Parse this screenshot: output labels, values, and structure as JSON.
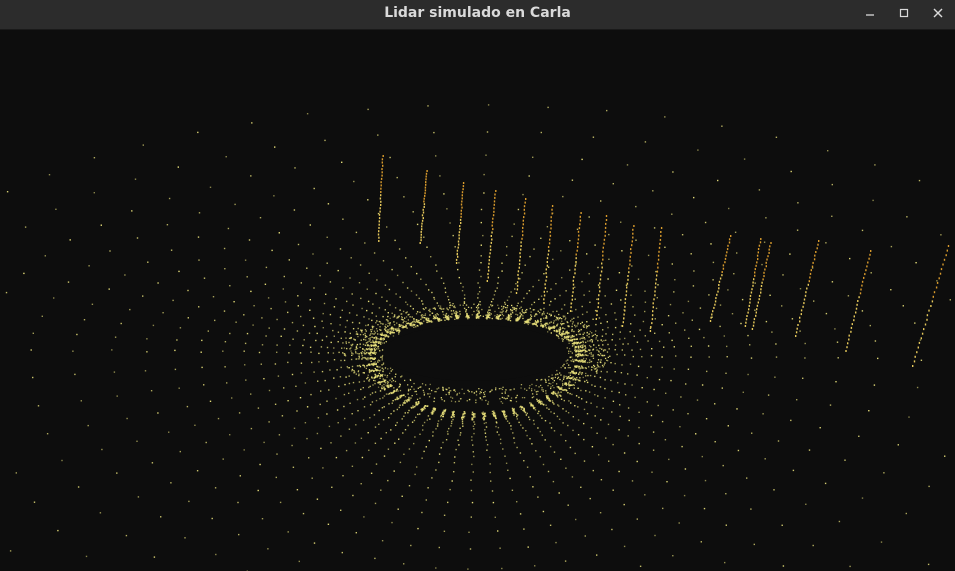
{
  "window": {
    "title": "Lidar simulado en Carla",
    "controls": [
      {
        "name": "minimize-button",
        "icon": "minimize-icon"
      },
      {
        "name": "maximize-button",
        "icon": "maximize-icon"
      },
      {
        "name": "close-button",
        "icon": "close-icon"
      }
    ]
  },
  "viewport": {
    "content": "lidar-point-cloud",
    "colors": {
      "background": "#0d0d0d",
      "ground_points": "#e8e07a",
      "high_points": "#d89a2c",
      "mid_points": "#e6c85a"
    }
  }
}
